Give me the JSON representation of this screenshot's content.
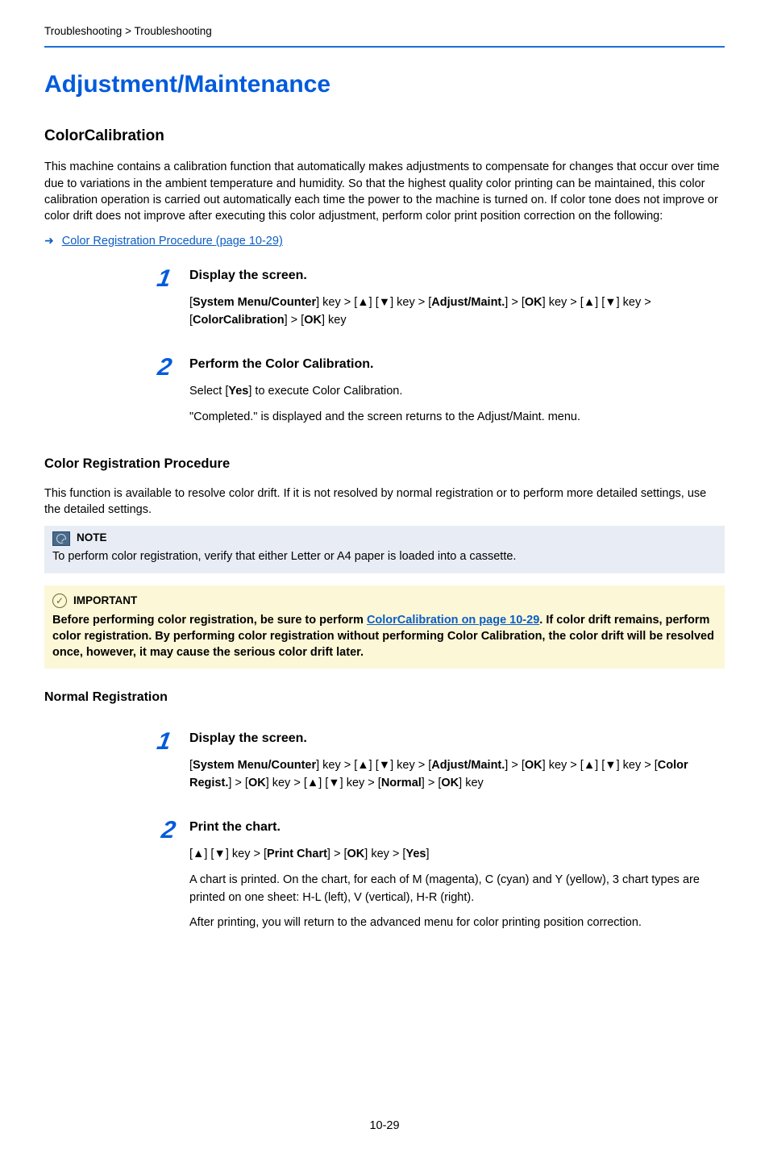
{
  "breadcrumb": "Troubleshooting > Troubleshooting",
  "page_title": "Adjustment/Maintenance",
  "section1": {
    "heading": "ColorCalibration",
    "body": "This machine contains a calibration function that automatically makes adjustments to compensate for changes that occur over time due to variations in the ambient temperature and humidity. So that the highest quality color printing can be maintained, this color calibration operation is carried out automatically each time the power to the machine is turned on. If color tone does not improve or color drift does not improve after executing this color adjustment, perform color print position correction on the following:",
    "link_text": "Color Registration Procedure (page 10-29)"
  },
  "steps1": [
    {
      "num": "1",
      "title": "Display the screen.",
      "lines": [
        {
          "type": "keyseq1"
        }
      ]
    },
    {
      "num": "2",
      "title": "Perform the Color Calibration.",
      "lines": [
        {
          "type": "yes_line"
        },
        {
          "type": "completed_line",
          "text": "\"Completed.\" is displayed and the screen returns to the Adjust/Maint. menu."
        }
      ]
    }
  ],
  "keyseq1_parts": {
    "p1": "System Menu/Counter",
    "p2": "Adjust/Maint.",
    "p3": "OK",
    "p4": "ColorCalibration",
    "p5": "OK"
  },
  "yes_line": {
    "pre": "Select [",
    "bold": "Yes",
    "post": "] to execute Color Calibration."
  },
  "section2": {
    "heading": "Color Registration Procedure",
    "body": "This function is available to resolve color drift. If it is not resolved by normal registration or to perform more detailed settings, use the detailed settings."
  },
  "note": {
    "label": "NOTE",
    "body": "To perform color registration, verify that either Letter or A4 paper is loaded into a cassette."
  },
  "important": {
    "label": "IMPORTANT",
    "pre": "Before performing color registration, be sure to perform ",
    "link": "ColorCalibration on page 10-29",
    "post": ". If color drift remains, perform color registration. By performing color registration without performing Color Calibration, the color drift will be resolved once, however, it may cause the serious color drift later."
  },
  "normal_reg_heading": "Normal Registration",
  "steps2": [
    {
      "num": "1",
      "title": "Display the screen.",
      "lines": [
        {
          "type": "keyseq2"
        }
      ]
    },
    {
      "num": "2",
      "title": "Print the chart.",
      "lines": [
        {
          "type": "keyseq3"
        },
        {
          "type": "plain",
          "text": "A chart is printed. On the chart, for each of M (magenta), C (cyan) and Y (yellow), 3 chart types are printed on one sheet: H-L (left), V (vertical), H-R (right)."
        },
        {
          "type": "plain",
          "text": "After printing, you will return to the advanced menu for color printing position correction."
        }
      ]
    }
  ],
  "keyseq2_parts": {
    "p1": "System Menu/Counter",
    "p2": "Adjust/Maint.",
    "p3": "OK",
    "p4": "Color Regist.",
    "p5": "OK",
    "p6": "Normal",
    "p7": "OK"
  },
  "keyseq3_parts": {
    "p1": "Print Chart",
    "p2": "OK",
    "p3": "Yes"
  },
  "page_number": "10-29"
}
